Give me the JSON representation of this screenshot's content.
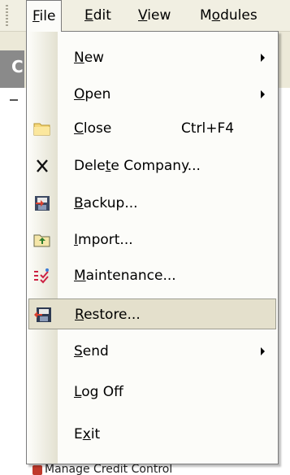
{
  "menubar": {
    "items": [
      {
        "label": "File",
        "mnemonic": "F",
        "rest": "ile"
      },
      {
        "label": "Edit",
        "mnemonic": "E",
        "rest": "dit"
      },
      {
        "label": "View",
        "mnemonic": "V",
        "rest": "iew"
      },
      {
        "label": "Modules",
        "pre": "M",
        "mnemonic": "o",
        "rest": "dules"
      }
    ]
  },
  "background": {
    "strip_letter": "C",
    "bottom_text": "Manage Credit Control"
  },
  "file_menu": {
    "items": [
      {
        "pre": "",
        "u": "N",
        "post": "ew",
        "submenu": true,
        "icon": ""
      },
      {
        "pre": "",
        "u": "O",
        "post": "pen",
        "submenu": true,
        "icon": ""
      },
      {
        "pre": "",
        "u": "C",
        "post": "lose",
        "shortcut": "Ctrl+F4",
        "icon": "folder-icon"
      },
      {
        "pre": "Dele",
        "u": "t",
        "post": "e Company...",
        "icon": "delete-x-icon"
      },
      {
        "pre": "",
        "u": "B",
        "post": "ackup...",
        "icon": "backup-icon"
      },
      {
        "pre": "",
        "u": "I",
        "post": "mport...",
        "icon": "import-icon"
      },
      {
        "pre": "",
        "u": "M",
        "post": "aintenance...",
        "icon": "maintenance-icon"
      },
      {
        "pre": "",
        "u": "R",
        "post": "estore...",
        "icon": "restore-icon",
        "highlighted": true
      },
      {
        "pre": "",
        "u": "S",
        "post": "end",
        "submenu": true,
        "icon": ""
      },
      {
        "pre": "",
        "u": "L",
        "post": "og Off",
        "icon": ""
      },
      {
        "pre": "E",
        "u": "x",
        "post": "it",
        "icon": ""
      }
    ]
  },
  "colors": {
    "highlight": "#e4e0cc",
    "menu_border": "#7b7b7b"
  }
}
